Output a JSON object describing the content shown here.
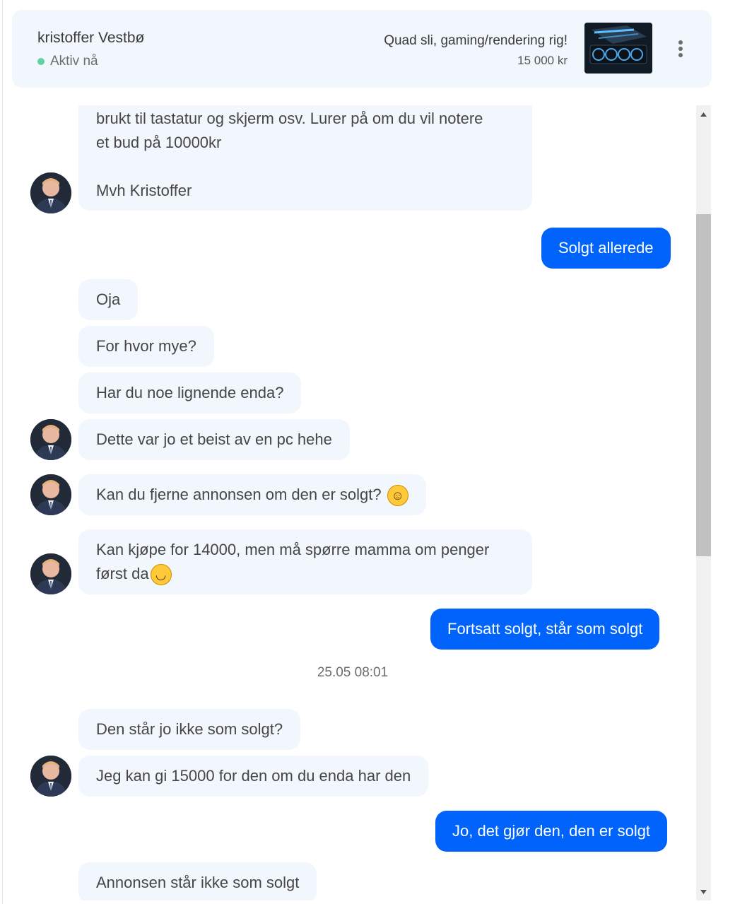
{
  "header": {
    "contact_name": "kristoffer Vestbø",
    "status": "Aktiv nå",
    "ad_title": "Quad sli, gaming/rendering rig!",
    "ad_price": "15 000 kr",
    "more_icon": "more-vertical-icon"
  },
  "messages": [
    {
      "dir": "in",
      "lines": [
        "brukt til tastatur og skjerm osv. Lurer på om du vil notere",
        "et bud på 10000kr",
        "",
        "Mvh Kristoffer"
      ]
    },
    {
      "dir": "out",
      "text": "Solgt allerede"
    },
    {
      "dir": "in",
      "text": "Oja"
    },
    {
      "dir": "in",
      "text": "For hvor mye?"
    },
    {
      "dir": "in",
      "text": "Har du noe lignende enda?"
    },
    {
      "dir": "in",
      "text": "Dette var jo et beist av en pc hehe"
    },
    {
      "dir": "in",
      "text": "Kan du fjerne annonsen om den er solgt?",
      "emoji": "grinning-sweat-emoji"
    },
    {
      "dir": "in",
      "lines": [
        "Kan kjøpe for 14000, men må spørre mamma om penger",
        "først da"
      ],
      "emoji": "upside-down-face-emoji"
    },
    {
      "dir": "out",
      "text": "Fortsatt solgt, står som solgt"
    },
    {
      "dir": "in",
      "text": "Den står jo ikke som solgt?"
    },
    {
      "dir": "in",
      "text": "Jeg kan gi 15000 for den om du enda har den"
    },
    {
      "dir": "out",
      "text": "Jo, det gjør den, den er solgt"
    },
    {
      "dir": "in",
      "text": "Annonsen står ikke som solgt"
    }
  ],
  "timestamp": "25.05 08:01",
  "colors": {
    "incoming_bg": "#f1f7fd",
    "outgoing_bg": "#0063fb",
    "online": "#5fd3a3"
  }
}
